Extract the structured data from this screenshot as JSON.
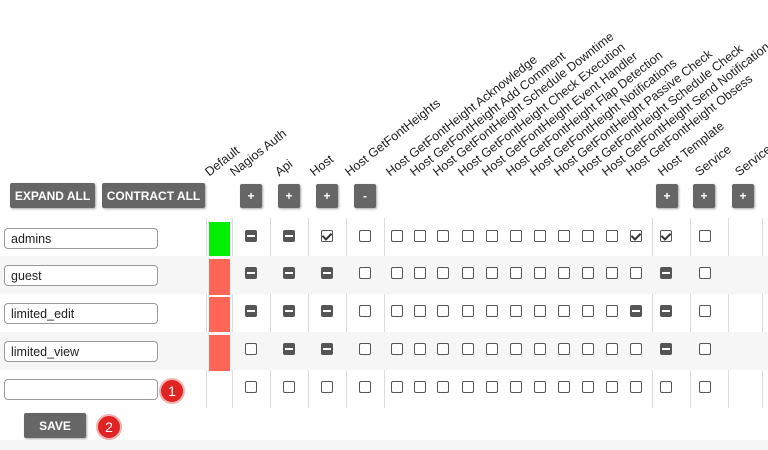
{
  "toolbar": {
    "expand_label": "EXPAND ALL",
    "contract_label": "CONTRACT ALL",
    "save_label": "SAVE"
  },
  "columns": [
    {
      "label": "Default"
    },
    {
      "label": "Nagios Auth"
    },
    {
      "label": "Api"
    },
    {
      "label": "Host"
    },
    {
      "label": "Host GetFontHeights"
    },
    {
      "label": "Host GetFontHeight Acknowledge"
    },
    {
      "label": "Host GetFontHeight Add Comment"
    },
    {
      "label": "Host GetFontHeight Schedule Downtime"
    },
    {
      "label": "Host GetFontHeight Check Execution"
    },
    {
      "label": "Host GetFontHeight Event Handler"
    },
    {
      "label": "Host GetFontHeight Flap Detection"
    },
    {
      "label": "Host GetFontHeight Notifications"
    },
    {
      "label": "Host GetFontHeight Passive Check"
    },
    {
      "label": "Host GetFontHeight Schedule Check"
    },
    {
      "label": "Host GetFontHeight Send Notification"
    },
    {
      "label": "Host GetFontHeight Obsess"
    },
    {
      "label": "Host Template"
    },
    {
      "label": "Service"
    },
    {
      "label": "Service G"
    }
  ],
  "expand_buttons": [
    {
      "col": "nagios-auth",
      "label": "+"
    },
    {
      "col": "api",
      "label": "+"
    },
    {
      "col": "host",
      "label": "+"
    },
    {
      "col": "host-getfontheights",
      "label": "-"
    },
    {
      "col": "host-template",
      "label": "+"
    },
    {
      "col": "service",
      "label": "+"
    },
    {
      "col": "service-g",
      "label": "+"
    }
  ],
  "rows": [
    {
      "name": "admins",
      "default_color": "#00ee00",
      "cells": [
        "i",
        "i",
        "c",
        "e",
        "e",
        "e",
        "e",
        "e",
        "e",
        "e",
        "e",
        "e",
        "e",
        "e",
        "c",
        "c",
        "e"
      ]
    },
    {
      "name": "guest",
      "default_color": "#ff6655",
      "cells": [
        "i",
        "i",
        "i",
        "e",
        "e",
        "e",
        "e",
        "e",
        "e",
        "e",
        "e",
        "e",
        "e",
        "e",
        "e",
        "i",
        "e"
      ]
    },
    {
      "name": "limited_edit",
      "default_color": "#ff6655",
      "cells": [
        "i",
        "i",
        "i",
        "e",
        "e",
        "e",
        "e",
        "e",
        "e",
        "e",
        "e",
        "e",
        "e",
        "e",
        "i",
        "i",
        "e"
      ]
    },
    {
      "name": "limited_view",
      "default_color": "#ff6655",
      "cells": [
        "e",
        "i",
        "i",
        "e",
        "e",
        "e",
        "e",
        "e",
        "e",
        "e",
        "e",
        "e",
        "e",
        "e",
        "e",
        "i",
        "e"
      ]
    },
    {
      "name": "",
      "default_color": "",
      "cells": [
        "e",
        "e",
        "e",
        "e",
        "e",
        "e",
        "e",
        "e",
        "e",
        "e",
        "e",
        "e",
        "e",
        "e",
        "e",
        "e",
        "e"
      ]
    }
  ],
  "badges": [
    {
      "label": "1"
    },
    {
      "label": "2"
    }
  ],
  "colors": {
    "button": "#666666",
    "default_on": "#00ee00",
    "default_off": "#ff6655",
    "badge": "#e02424"
  }
}
